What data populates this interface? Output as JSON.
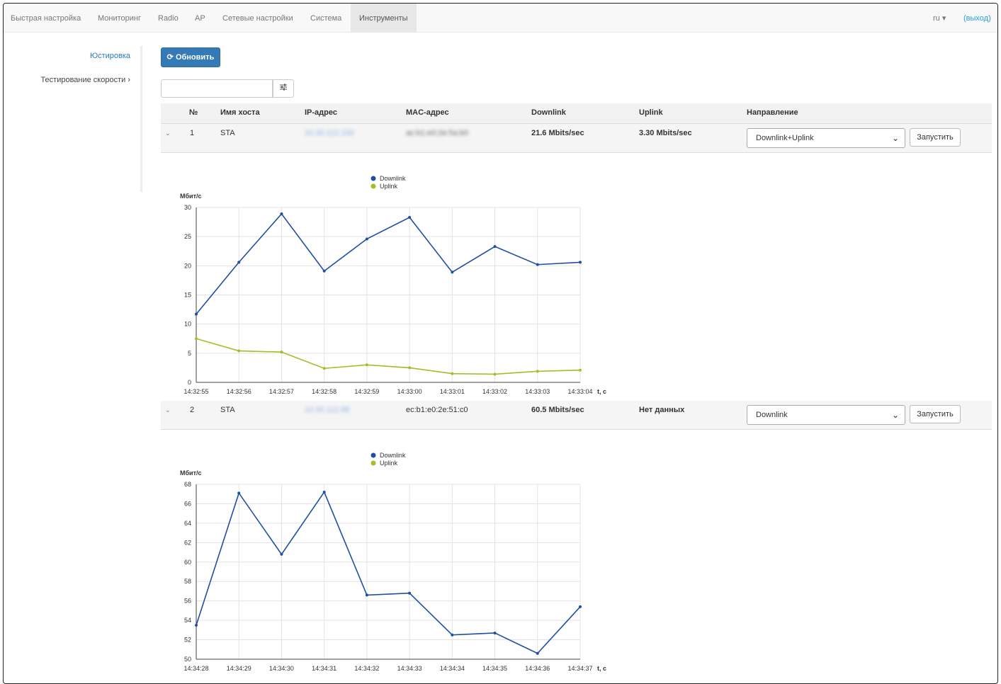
{
  "nav": {
    "items": [
      "Быстрая настройка",
      "Мониторинг",
      "Radio",
      "AP",
      "Сетевые настройки",
      "Система",
      "Инструменты"
    ],
    "active": "Инструменты",
    "lang": "ru ▾",
    "logout": "(выход)"
  },
  "sidebar": {
    "items": [
      {
        "label": "Юстировка",
        "active": true
      },
      {
        "label": "Тестирование скорости ›",
        "active": false
      }
    ]
  },
  "toolbar": {
    "refresh_label": "Обновить",
    "filter_value": ""
  },
  "table": {
    "headers": [
      "№",
      "Имя хоста",
      "IP-адрес",
      "MAC-адрес",
      "Downlink",
      "Uplink",
      "Направление"
    ],
    "rows": [
      {
        "num": "1",
        "hostname": "STA",
        "ip": "10.30.112.100",
        "mac": "ac:b1:e0:2e:5a:b0",
        "downlink": "21.6 Mbits/sec",
        "uplink": "3.30 Mbits/sec",
        "direction": "Downlink+Uplink",
        "run_label": "Запустить"
      },
      {
        "num": "2",
        "hostname": "STA",
        "ip": "10.30.112.88",
        "mac": "ec:b1:e0:2e:51:c0",
        "downlink": "60.5 Mbits/sec",
        "uplink": "Нет данных",
        "direction": "Downlink",
        "run_label": "Запустить"
      }
    ]
  },
  "colors": {
    "downlink": "#1f4fa3",
    "uplink": "#a9bb27",
    "accent": "#337ab7"
  },
  "chart_data": [
    {
      "type": "line",
      "ylabel": "Мбит/с",
      "xlabel": "t, c",
      "ylim": [
        0,
        30
      ],
      "yticks": [
        0,
        5,
        10,
        15,
        20,
        25,
        30
      ],
      "x": [
        "14:32:55",
        "14:32:56",
        "14:32:57",
        "14:32:58",
        "14:32:59",
        "14:33:00",
        "14:33:01",
        "14:33:02",
        "14:33:03",
        "14:33:04"
      ],
      "series": [
        {
          "name": "Downlink",
          "values": [
            11.7,
            20.6,
            28.9,
            19.1,
            24.6,
            28.3,
            18.9,
            23.3,
            20.2,
            20.6
          ]
        },
        {
          "name": "Uplink",
          "values": [
            7.5,
            5.4,
            5.2,
            2.4,
            3.0,
            2.5,
            1.5,
            1.4,
            1.9,
            2.1
          ]
        }
      ],
      "legend": "top",
      "grid": true
    },
    {
      "type": "line",
      "ylabel": "Мбит/с",
      "xlabel": "t, c",
      "ylim": [
        50,
        68
      ],
      "yticks": [
        50,
        52,
        54,
        56,
        58,
        60,
        62,
        64,
        66,
        68
      ],
      "x": [
        "14:34:28",
        "14:34:29",
        "14:34:30",
        "14:34:31",
        "14:34:32",
        "14:34:33",
        "14:34:34",
        "14:34:35",
        "14:34:36",
        "14:34:37"
      ],
      "series": [
        {
          "name": "Downlink",
          "values": [
            53.5,
            67.1,
            60.8,
            67.2,
            56.6,
            56.8,
            52.5,
            52.7,
            50.6,
            55.4
          ]
        }
      ],
      "legend_entries": [
        "Downlink",
        "Uplink"
      ],
      "legend": "top",
      "grid": true
    }
  ]
}
